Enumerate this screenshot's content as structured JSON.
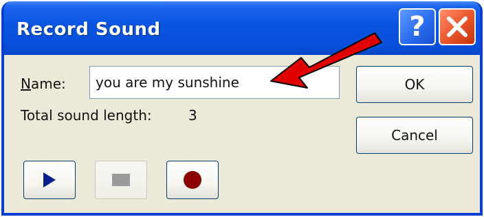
{
  "dialog": {
    "title": "Record Sound",
    "name_label_accel": "N",
    "name_label_rest": "ame:",
    "name_value": "you are my sunshine",
    "length_label": "Total sound length:",
    "length_value": "3",
    "ok_label": "OK",
    "cancel_label": "Cancel",
    "help_glyph": "?"
  },
  "icons": {
    "play": "play-icon",
    "stop": "stop-icon",
    "record": "record-icon",
    "close": "close-icon",
    "help": "help-icon",
    "annotation": "red-arrow"
  },
  "colors": {
    "titlebar": "#0854e0",
    "dialog_bg": "#ece9d8",
    "play": "#0a1f8c",
    "stop": "#9a9a9a",
    "record": "#8b0000",
    "close": "#e8542a",
    "arrow": "#e00000"
  }
}
